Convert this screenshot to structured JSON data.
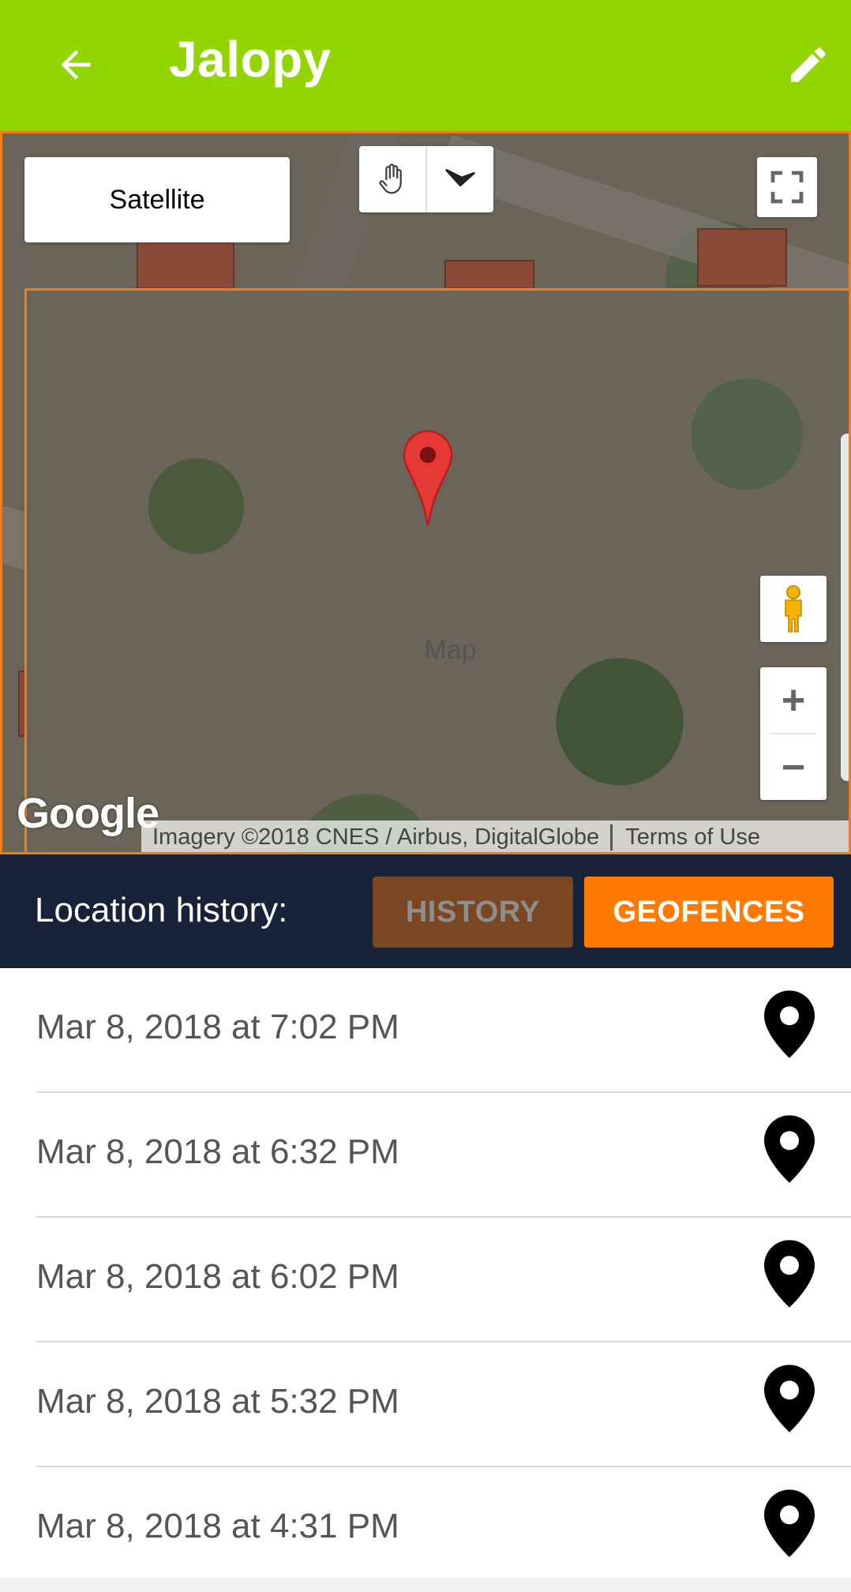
{
  "app_bar": {
    "title": "Jalopy",
    "back_icon": "arrow-left-icon",
    "edit_icon": "pencil-icon",
    "color": "#93d500"
  },
  "map": {
    "type_control": {
      "map_label": "Map",
      "satellite_label": "Satellite",
      "selected": "Satellite"
    },
    "logo": "Google",
    "attribution": "Imagery ©2018 CNES / Airbus, DigitalGlobe",
    "terms": "Terms of Use",
    "zoom_in": "+",
    "zoom_out": "−",
    "marker_color": "#e53935",
    "border_color": "#f07d1a"
  },
  "history_bar": {
    "label": "Location history:",
    "history_button": "HISTORY",
    "geofences_button": "GEOFENCES",
    "history_color": "#7a4722",
    "geofences_color": "#ff7a00",
    "background": "#16213a"
  },
  "locations": [
    {
      "time": "Mar 8, 2018 at 7:02 PM"
    },
    {
      "time": "Mar 8, 2018 at 6:32 PM"
    },
    {
      "time": "Mar 8, 2018 at 6:02 PM"
    },
    {
      "time": "Mar 8, 2018 at 5:32 PM"
    },
    {
      "time": "Mar 8, 2018 at 4:31 PM"
    }
  ]
}
